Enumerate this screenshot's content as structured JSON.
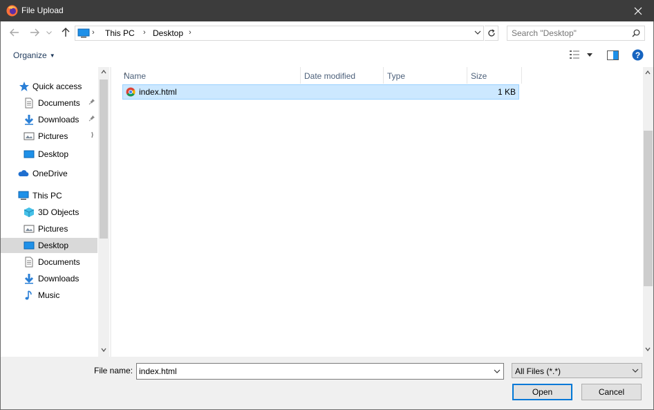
{
  "window": {
    "title": "File Upload",
    "app_icon": "firefox-icon"
  },
  "address": {
    "crumbs": [
      "This PC",
      "Desktop"
    ]
  },
  "search": {
    "placeholder": "Search \"Desktop\""
  },
  "toolbar": {
    "organize_label": "Organize"
  },
  "nav": {
    "items": [
      {
        "label": "Quick access",
        "icon": "star-icon",
        "level": 0,
        "pinned": false
      },
      {
        "label": "Documents",
        "icon": "document-icon",
        "level": 1,
        "pinned": true
      },
      {
        "label": "Downloads",
        "icon": "download-arrow-icon",
        "level": 1,
        "pinned": true
      },
      {
        "label": "Pictures",
        "icon": "pictures-icon",
        "level": 1,
        "pinned": true
      },
      {
        "label": "Desktop",
        "icon": "desktop-icon",
        "level": 1,
        "pinned": false
      },
      {
        "label": "OneDrive",
        "icon": "cloud-icon",
        "level": 0,
        "pinned": false
      },
      {
        "label": "This PC",
        "icon": "computer-icon",
        "level": 0,
        "pinned": false
      },
      {
        "label": "3D Objects",
        "icon": "cube-icon",
        "level": 1,
        "pinned": false
      },
      {
        "label": "Pictures",
        "icon": "pictures-icon",
        "level": 1,
        "pinned": false
      },
      {
        "label": "Desktop",
        "icon": "desktop-icon",
        "level": 1,
        "pinned": false,
        "selected": true
      },
      {
        "label": "Documents",
        "icon": "document-icon",
        "level": 1,
        "pinned": false
      },
      {
        "label": "Downloads",
        "icon": "download-arrow-icon",
        "level": 1,
        "pinned": false
      },
      {
        "label": "Music",
        "icon": "music-note-icon",
        "level": 1,
        "pinned": false
      }
    ]
  },
  "columns": [
    "Name",
    "Date modified",
    "Type",
    "Size"
  ],
  "files": [
    {
      "name": "index.html",
      "date": "",
      "type": "",
      "size": "1 KB",
      "icon": "chrome-icon",
      "selected": true
    }
  ],
  "bottom": {
    "filename_label": "File name:",
    "filename_value": "index.html",
    "filter_value": "All Files (*.*)",
    "open_label": "Open",
    "cancel_label": "Cancel"
  },
  "colors": {
    "accent": "#0078d7",
    "selection": "#cce8ff",
    "titlebar": "#3c3c3c"
  }
}
